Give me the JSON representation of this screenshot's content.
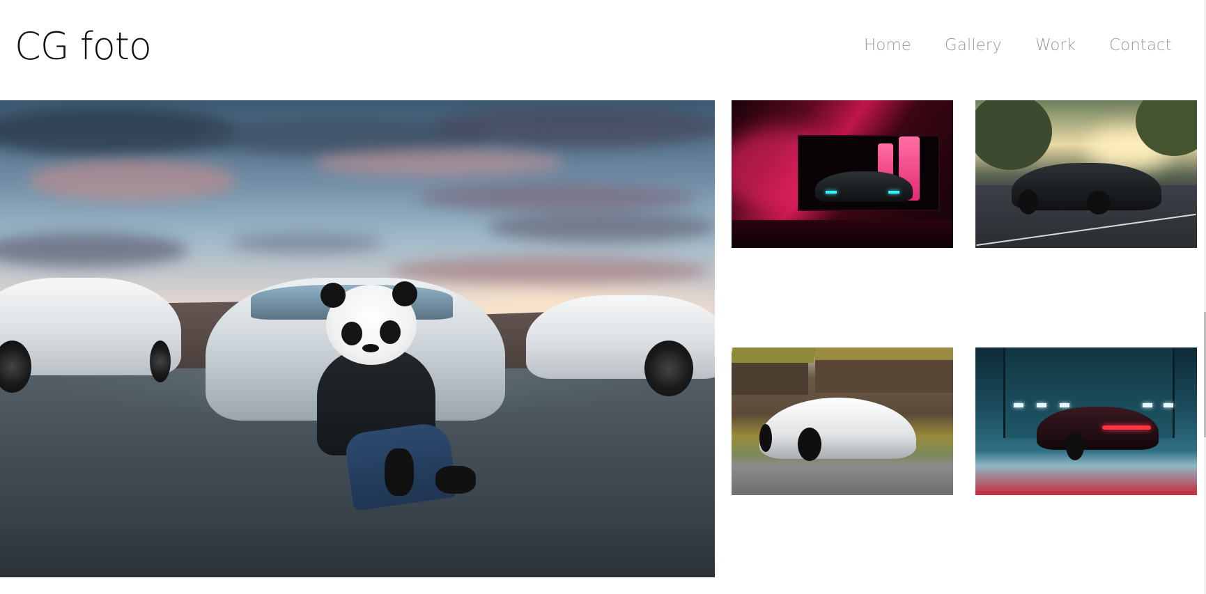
{
  "site": {
    "logo_text": "CG foto"
  },
  "nav": {
    "items": [
      {
        "label": "Home"
      },
      {
        "label": "Gallery"
      },
      {
        "label": "Work"
      },
      {
        "label": "Contact"
      }
    ]
  },
  "colors": {
    "background": "#ffffff",
    "logo": "#111111",
    "nav_link": "#9a9a9a"
  },
  "gallery": {
    "hero": {
      "subject": "panda-mask-person-with-sports-cars"
    },
    "thumbnails": [
      {
        "subject": "car-in-neon-pink-garage"
      },
      {
        "subject": "black-mustang-at-sunset-parking"
      },
      {
        "subject": "white-mclaren-by-wooden-houses"
      },
      {
        "subject": "dark-challenger-in-hangar"
      }
    ]
  }
}
